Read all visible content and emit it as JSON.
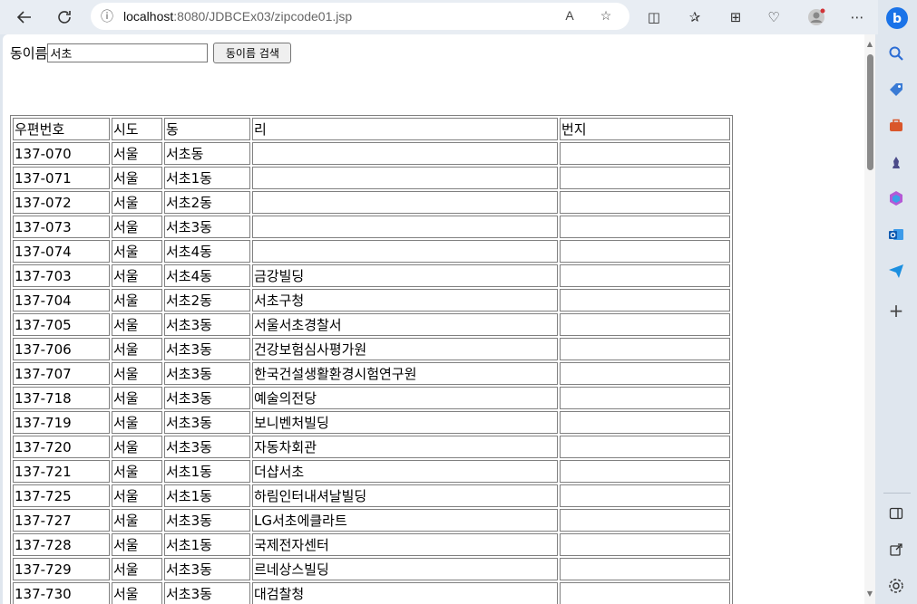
{
  "browser": {
    "url_host": "localhost",
    "url_path": ":8080/JDBCEx03/zipcode01.jsp",
    "icons": {
      "back": "back-arrow-icon",
      "refresh": "refresh-icon",
      "info": "info-icon",
      "read_aloud": "read-aloud-icon",
      "favorite": "star-icon",
      "split": "split-screen-icon",
      "favorites": "favorites-icon",
      "collections": "collections-icon",
      "health": "heart-icon",
      "profile": "profile-icon",
      "more": "more-icon",
      "copilot": "copilot-icon"
    }
  },
  "form": {
    "label": "동이름",
    "input_value": "서초",
    "button_label": "동이름 검색"
  },
  "table": {
    "headers": [
      "우편번호",
      "시도",
      "동",
      "리",
      "번지"
    ],
    "rows": [
      [
        "137-070",
        "서울",
        "서초동",
        "",
        ""
      ],
      [
        "137-071",
        "서울",
        "서초1동",
        "",
        ""
      ],
      [
        "137-072",
        "서울",
        "서초2동",
        "",
        ""
      ],
      [
        "137-073",
        "서울",
        "서초3동",
        "",
        ""
      ],
      [
        "137-074",
        "서울",
        "서초4동",
        "",
        ""
      ],
      [
        "137-703",
        "서울",
        "서초4동",
        "금강빌딩",
        ""
      ],
      [
        "137-704",
        "서울",
        "서초2동",
        "서초구청",
        ""
      ],
      [
        "137-705",
        "서울",
        "서초3동",
        "서울서초경찰서",
        ""
      ],
      [
        "137-706",
        "서울",
        "서초3동",
        "건강보험심사평가원",
        ""
      ],
      [
        "137-707",
        "서울",
        "서초3동",
        "한국건설생활환경시험연구원",
        ""
      ],
      [
        "137-718",
        "서울",
        "서초3동",
        "예술의전당",
        ""
      ],
      [
        "137-719",
        "서울",
        "서초3동",
        "보니벤처빌딩",
        ""
      ],
      [
        "137-720",
        "서울",
        "서초3동",
        "자동차회관",
        ""
      ],
      [
        "137-721",
        "서울",
        "서초1동",
        "더샵서초",
        ""
      ],
      [
        "137-725",
        "서울",
        "서초1동",
        "하림인터내셔날빌딩",
        ""
      ],
      [
        "137-727",
        "서울",
        "서초3동",
        "LG서초에클라트",
        ""
      ],
      [
        "137-728",
        "서울",
        "서초1동",
        "국제전자센터",
        ""
      ],
      [
        "137-729",
        "서울",
        "서초3동",
        "르네상스빌딩",
        ""
      ],
      [
        "137-730",
        "서울",
        "서초3동",
        "대검찰청",
        ""
      ]
    ]
  },
  "sidebar": {
    "icons": [
      "search-icon",
      "tag-icon",
      "briefcase-icon",
      "chess-icon",
      "office-icon",
      "outlook-icon",
      "send-icon",
      "plus-icon",
      "sidebar-toggle-icon",
      "external-link-icon",
      "settings-icon"
    ]
  },
  "colors": {
    "browser_chrome": "#e8edf3",
    "page_background": "#ffffff",
    "table_border": "#808080"
  }
}
